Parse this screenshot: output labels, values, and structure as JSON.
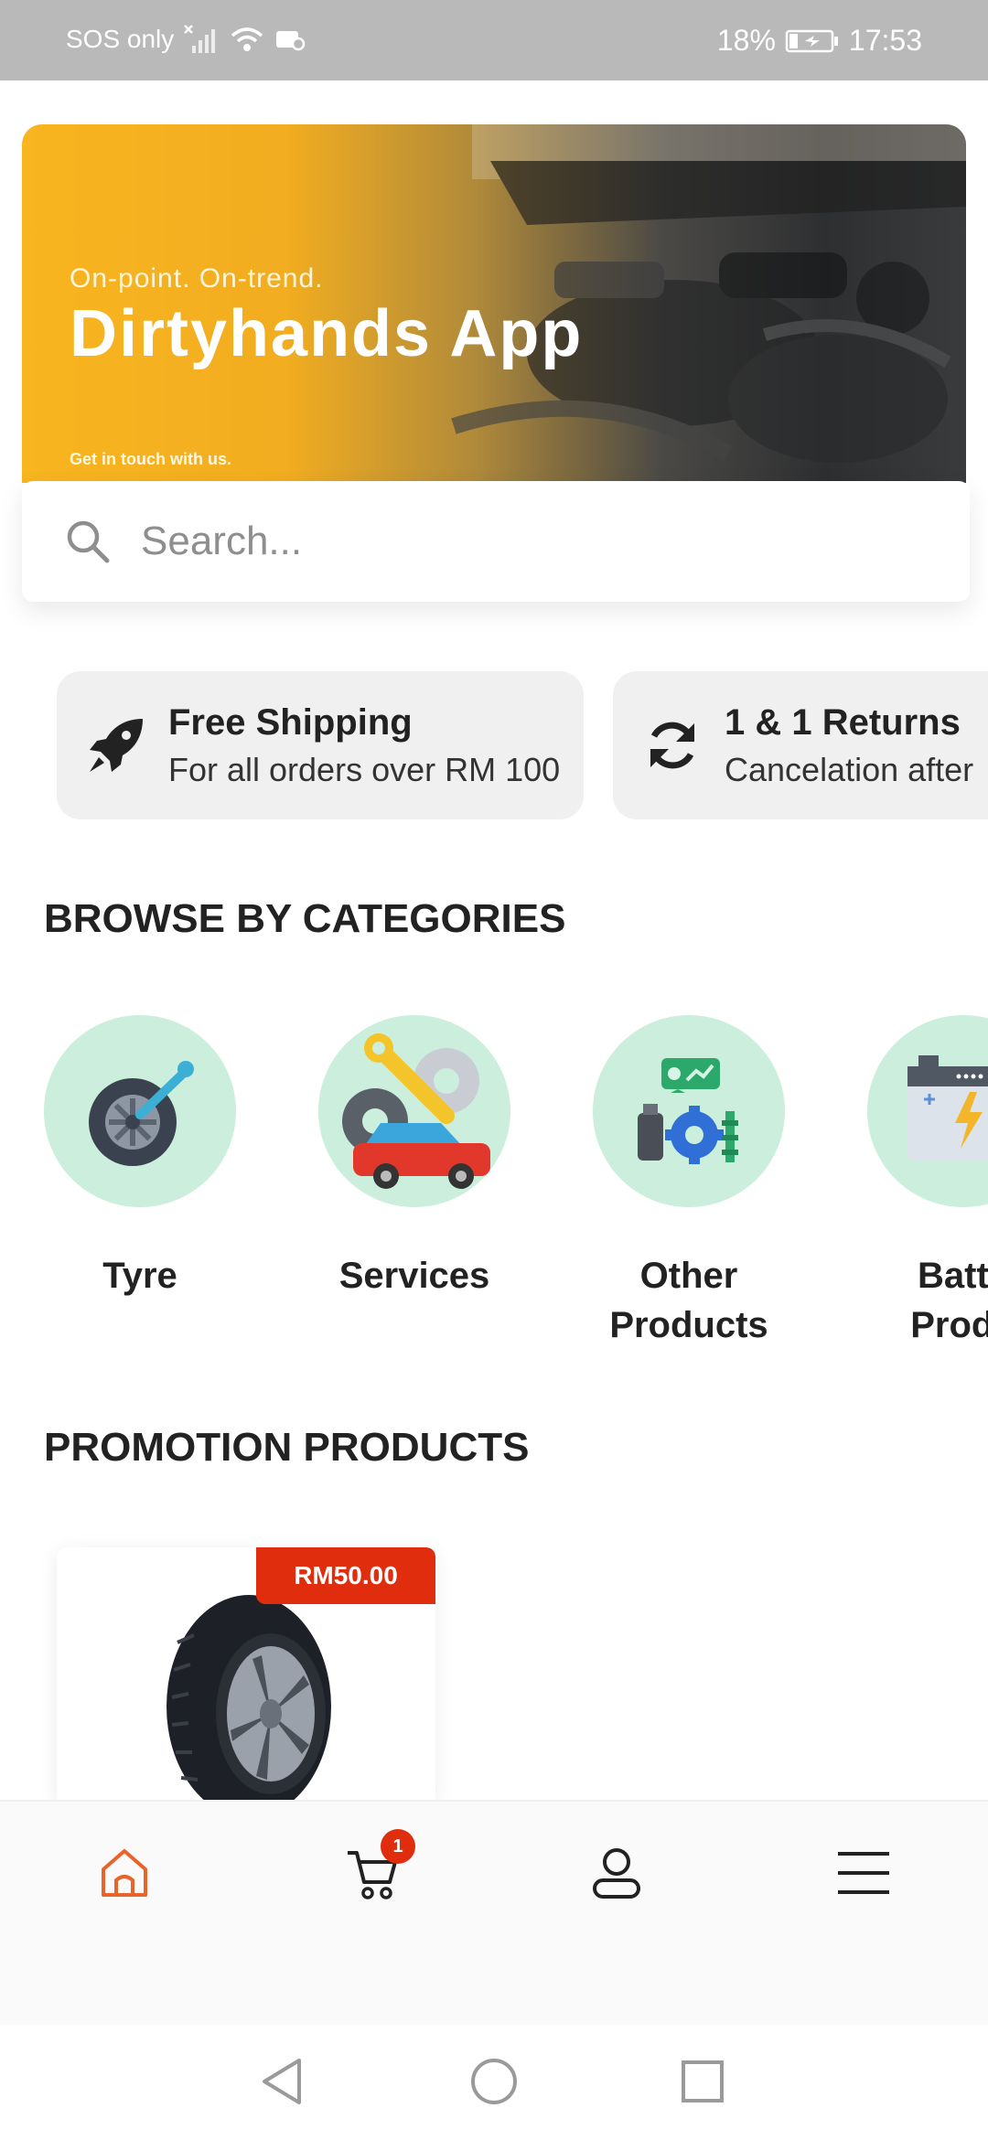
{
  "status_bar": {
    "network": "SOS only",
    "battery": "18%",
    "time": "17:53"
  },
  "hero": {
    "tagline": "On-point. On-trend.",
    "title": "Dirtyhands App",
    "contact": "Get in touch with us."
  },
  "search": {
    "placeholder": "Search..."
  },
  "features": [
    {
      "icon": "rocket-icon",
      "title": "Free Shipping",
      "subtitle": "For all orders over RM 100"
    },
    {
      "icon": "refresh-icon",
      "title": "1 & 1 Returns",
      "subtitle": "Cancelation after"
    }
  ],
  "categories_section": {
    "title": "BROWSE BY CATEGORIES",
    "items": [
      {
        "label_line1": "Tyre",
        "label_line2": "",
        "icon": "tyre-icon"
      },
      {
        "label_line1": "Services",
        "label_line2": "",
        "icon": "car-repair-icon"
      },
      {
        "label_line1": "Other",
        "label_line2": "Products",
        "icon": "parts-icon"
      },
      {
        "label_line1": "Batte",
        "label_line2": "Produ",
        "icon": "battery-icon"
      }
    ]
  },
  "promotion_section": {
    "title": "PROMOTION PRODUCTS",
    "products": [
      {
        "price": "RM50.00",
        "image": "tyre-product-image"
      }
    ]
  },
  "bottom_nav": {
    "active": "home",
    "cart_count": "1",
    "accent_color": "#e8642a"
  },
  "colors": {
    "banner_yellow": "#f8b51f",
    "category_circle": "#cbeedd",
    "price_tag": "#e02d0e"
  }
}
